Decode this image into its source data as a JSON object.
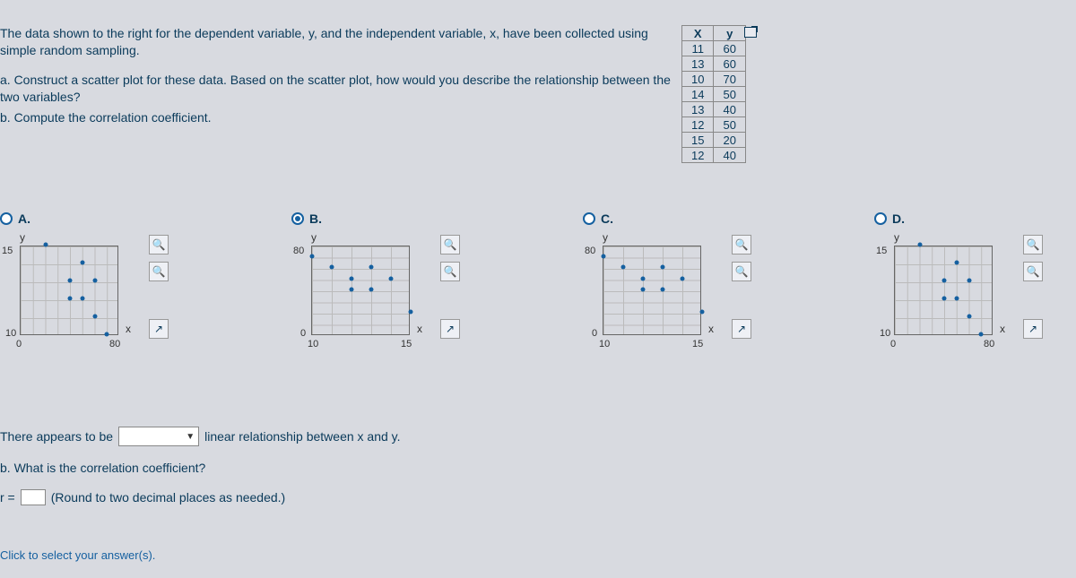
{
  "problem": {
    "intro": "The data shown to the right for the dependent variable, y, and the independent variable, x, have been collected using simple random sampling.",
    "partA": "a. Construct a scatter plot for these data. Based on the scatter plot, how would you describe the relationship between the two variables?",
    "partB": "b. Compute the correlation coefficient."
  },
  "table": {
    "headers": {
      "x": "X",
      "y": "y"
    },
    "rows": [
      {
        "x": "11",
        "y": "60"
      },
      {
        "x": "13",
        "y": "60"
      },
      {
        "x": "10",
        "y": "70"
      },
      {
        "x": "14",
        "y": "50"
      },
      {
        "x": "13",
        "y": "40"
      },
      {
        "x": "12",
        "y": "50"
      },
      {
        "x": "15",
        "y": "20"
      },
      {
        "x": "12",
        "y": "40"
      }
    ]
  },
  "options": {
    "A": {
      "label": "A.",
      "ylabel_top": "y",
      "xlabel_right": "x",
      "ytick_top": "15",
      "ytick_bot": "10",
      "xtick_l": "0",
      "xtick_r": "80"
    },
    "B": {
      "label": "B.",
      "ylabel_top": "y",
      "xlabel_right": "x",
      "ytick_top": "80",
      "ytick_bot": "0",
      "xtick_l": "10",
      "xtick_r": "15"
    },
    "C": {
      "label": "C.",
      "ylabel_top": "y",
      "xlabel_right": "x",
      "ytick_top": "80",
      "ytick_bot": "0",
      "xtick_l": "10",
      "xtick_r": "15"
    },
    "D": {
      "label": "D.",
      "ylabel_top": "y",
      "xlabel_right": "x",
      "ytick_top": "15",
      "ytick_bot": "10",
      "xtick_l": "0",
      "xtick_r": "80"
    }
  },
  "chart_data": [
    {
      "type": "scatter",
      "option": "A",
      "xlabel": "x",
      "ylabel": "y",
      "xlim": [
        0,
        80
      ],
      "ylim": [
        10,
        15
      ],
      "points": [
        [
          20,
          15
        ],
        [
          40,
          12
        ],
        [
          40,
          13
        ],
        [
          50,
          12
        ],
        [
          50,
          14
        ],
        [
          60,
          11
        ],
        [
          60,
          13
        ],
        [
          70,
          10
        ]
      ]
    },
    {
      "type": "scatter",
      "option": "B",
      "xlabel": "x",
      "ylabel": "y",
      "xlim": [
        10,
        15
      ],
      "ylim": [
        0,
        80
      ],
      "points": [
        [
          10,
          70
        ],
        [
          11,
          60
        ],
        [
          12,
          40
        ],
        [
          12,
          50
        ],
        [
          13,
          40
        ],
        [
          13,
          60
        ],
        [
          14,
          50
        ],
        [
          15,
          20
        ]
      ]
    },
    {
      "type": "scatter",
      "option": "C",
      "xlabel": "x",
      "ylabel": "y",
      "xlim": [
        10,
        15
      ],
      "ylim": [
        0,
        80
      ],
      "points": [
        [
          10,
          70
        ],
        [
          11,
          60
        ],
        [
          12,
          40
        ],
        [
          12,
          50
        ],
        [
          13,
          40
        ],
        [
          13,
          60
        ],
        [
          14,
          50
        ],
        [
          15,
          20
        ]
      ]
    },
    {
      "type": "scatter",
      "option": "D",
      "xlabel": "x",
      "ylabel": "y",
      "xlim": [
        0,
        80
      ],
      "ylim": [
        10,
        15
      ],
      "points": [
        [
          20,
          15
        ],
        [
          40,
          12
        ],
        [
          40,
          13
        ],
        [
          50,
          12
        ],
        [
          50,
          14
        ],
        [
          60,
          11
        ],
        [
          60,
          13
        ],
        [
          70,
          10
        ]
      ]
    }
  ],
  "bottom": {
    "sentence_pre": "There appears to be",
    "sentence_post": "linear relationship between x and y.",
    "partB_prompt": "b. What is the correlation coefficient?",
    "r_prefix": "r =",
    "r_note": "(Round to two decimal places as needed.)",
    "click_select": "Click to select your answer(s)."
  },
  "selected": "B"
}
